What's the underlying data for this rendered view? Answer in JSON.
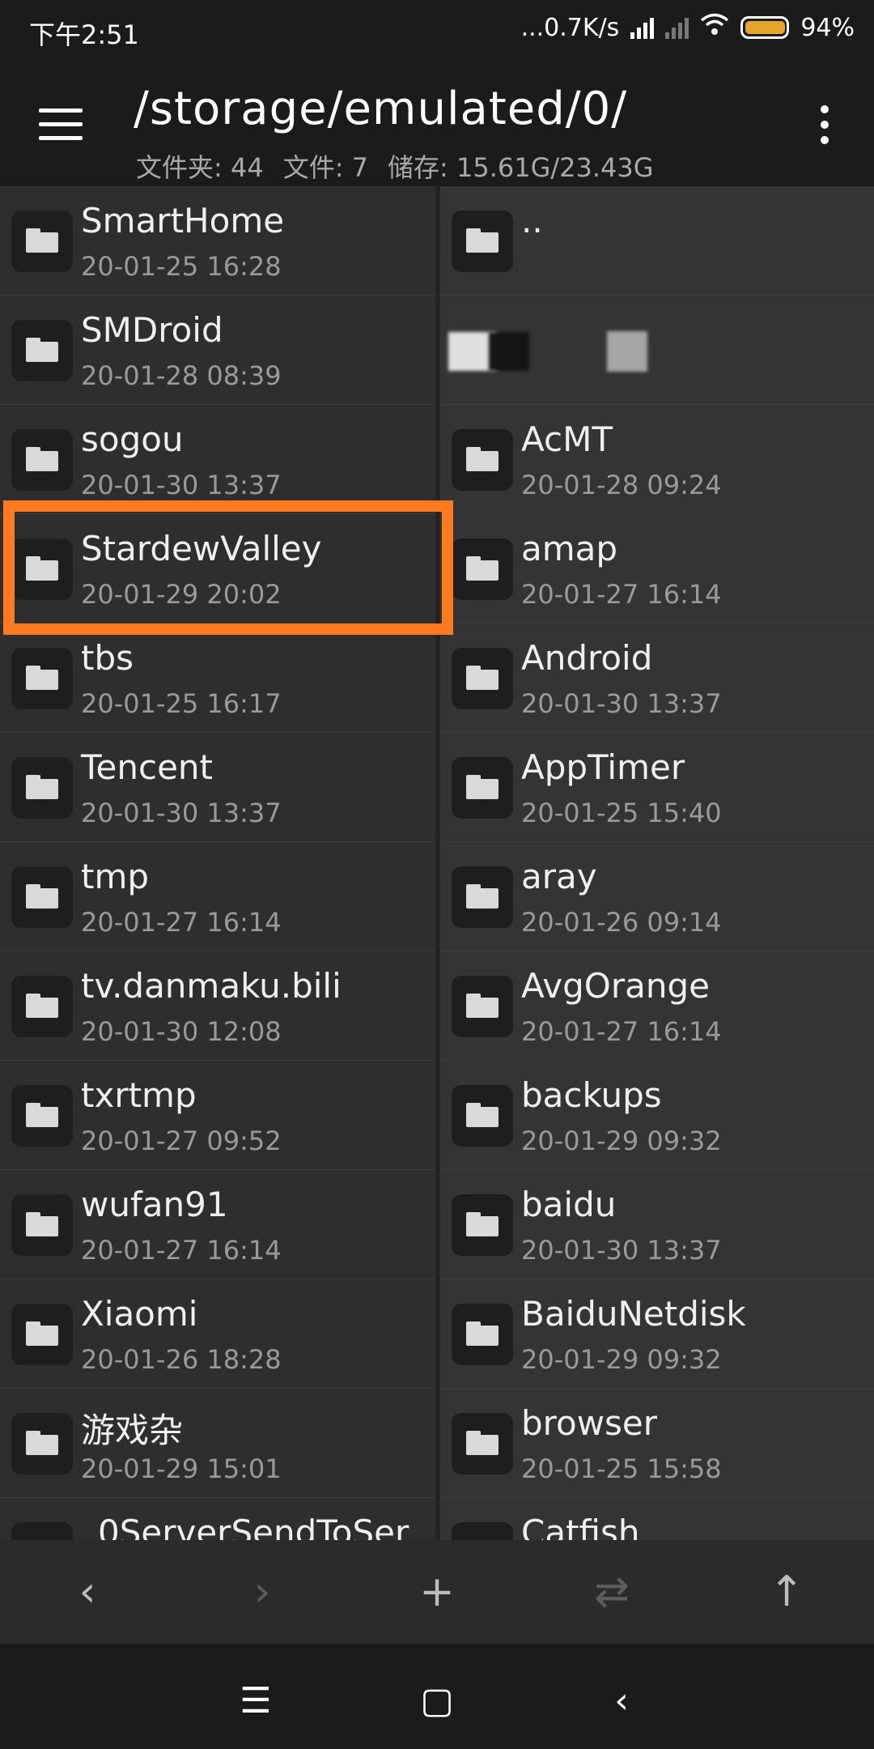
{
  "status": {
    "time": "下午2:51",
    "net_speed": "...0.7K/s",
    "battery": "94%"
  },
  "appbar": {
    "path": "/storage/emulated/0/",
    "folders_label": "文件夹: 44",
    "files_label": "文件: 7",
    "storage_label": "储存: 15.61G/23.43G"
  },
  "left_pane": [
    {
      "name": "SmartHome",
      "date": "20-01-25 16:28"
    },
    {
      "name": "SMDroid",
      "date": "20-01-28 08:39"
    },
    {
      "name": "sogou",
      "date": "20-01-30 13:37"
    },
    {
      "name": "StardewValley",
      "date": "20-01-29 20:02"
    },
    {
      "name": "tbs",
      "date": "20-01-25 16:17"
    },
    {
      "name": "Tencent",
      "date": "20-01-30 13:37"
    },
    {
      "name": "tmp",
      "date": "20-01-27 16:14"
    },
    {
      "name": "tv.danmaku.bili",
      "date": "20-01-30 12:08"
    },
    {
      "name": "txrtmp",
      "date": "20-01-27 09:52"
    },
    {
      "name": "wufan91",
      "date": "20-01-27 16:14"
    },
    {
      "name": "Xiaomi",
      "date": "20-01-26 18:28"
    },
    {
      "name": "游戏杂",
      "date": "20-01-29 15:01"
    },
    {
      "name": "_0ServerSendToSer",
      "date": ""
    }
  ],
  "right_pane": [
    {
      "name": "..",
      "date": ""
    },
    {
      "name": "",
      "date": ""
    },
    {
      "name": "AcMT",
      "date": "20-01-28 09:24"
    },
    {
      "name": "amap",
      "date": "20-01-27 16:14"
    },
    {
      "name": "Android",
      "date": "20-01-30 13:37"
    },
    {
      "name": "AppTimer",
      "date": "20-01-25 15:40"
    },
    {
      "name": "aray",
      "date": "20-01-26 09:14"
    },
    {
      "name": "AvgOrange",
      "date": "20-01-27 16:14"
    },
    {
      "name": "backups",
      "date": "20-01-29 09:32"
    },
    {
      "name": "baidu",
      "date": "20-01-30 13:37"
    },
    {
      "name": "BaiduNetdisk",
      "date": "20-01-29 09:32"
    },
    {
      "name": "browser",
      "date": "20-01-25 15:58"
    },
    {
      "name": "Catfish",
      "date": ""
    }
  ],
  "toolbar": {
    "back_icon": "‹",
    "forward_icon": "›",
    "add_icon": "+",
    "swap_icon": "⇄",
    "up_icon": "↑"
  },
  "navbar": {
    "menu_icon": "☰",
    "home_icon": "▢",
    "back_icon": "‹"
  }
}
